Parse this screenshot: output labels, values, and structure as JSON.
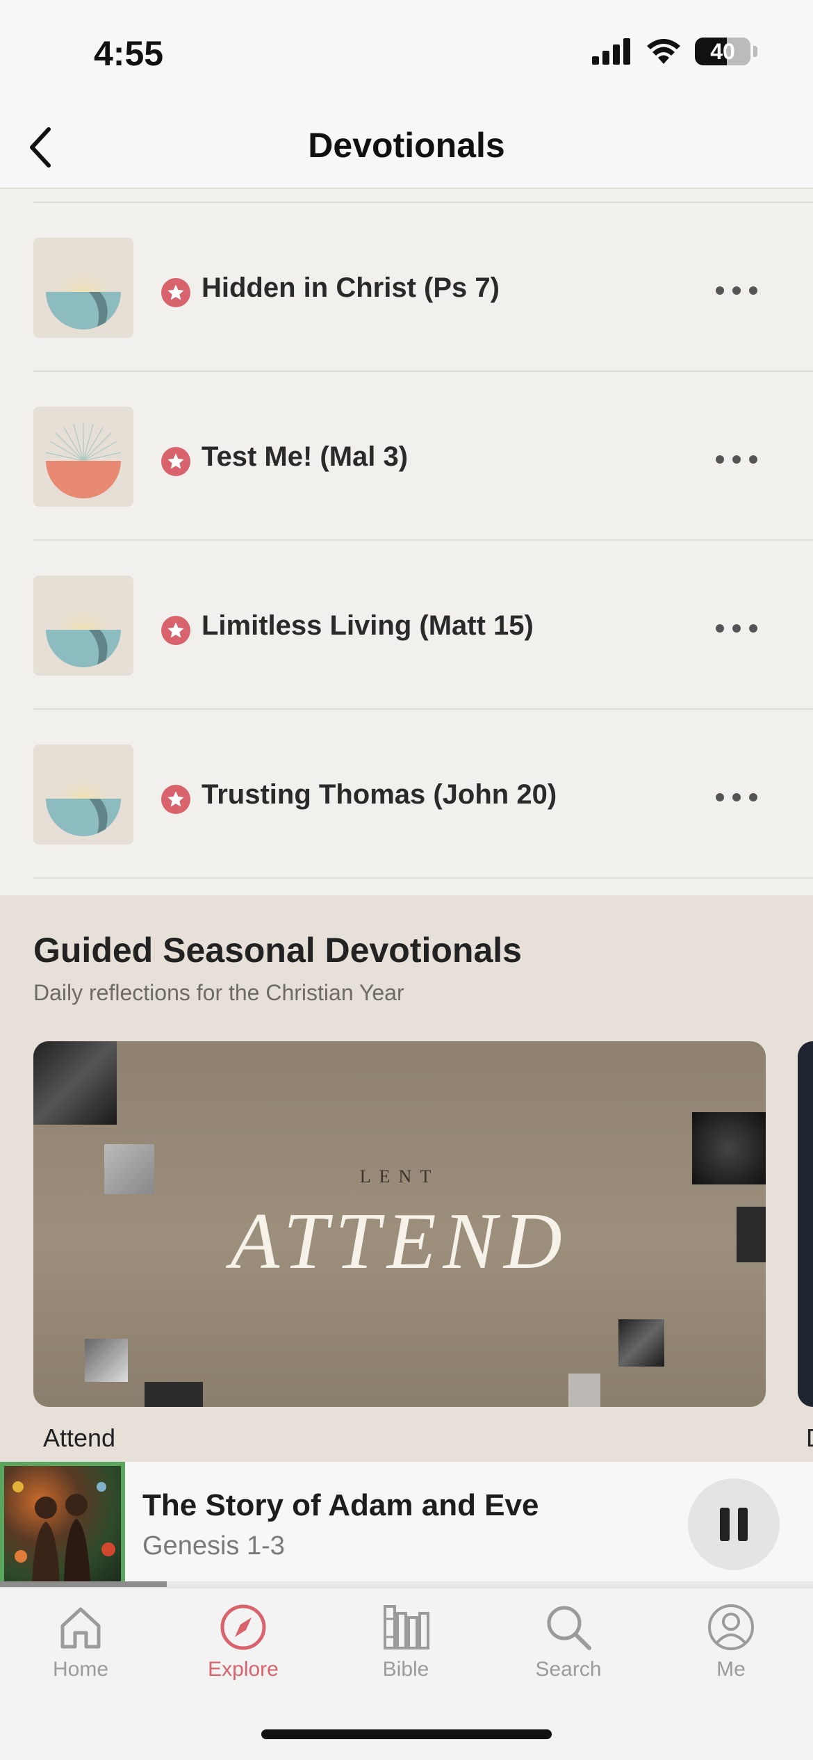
{
  "status_bar": {
    "time": "4:55",
    "battery_level": "40"
  },
  "header": {
    "title": "Devotionals",
    "back_icon": "chevron-left-icon"
  },
  "devotionals": [
    {
      "title": "Hidden in Christ (Ps 7)",
      "thumb": "teal-sunrise",
      "badge_icon": "star-icon"
    },
    {
      "title": "Test Me! (Mal 3)",
      "thumb": "coral-sunburst",
      "badge_icon": "star-icon"
    },
    {
      "title": "Limitless Living (Matt 15)",
      "thumb": "teal-sunrise",
      "badge_icon": "star-icon"
    },
    {
      "title": "Trusting Thomas (John 20)",
      "thumb": "teal-sunrise",
      "badge_icon": "star-icon"
    }
  ],
  "seasonal": {
    "title": "Guided Seasonal Devotionals",
    "subtitle": "Daily reflections for the Christian Year",
    "cards": [
      {
        "kicker": "LENT",
        "title": "ATTEND",
        "caption": "Attend"
      },
      {
        "kicker": "",
        "title": "",
        "caption": "D"
      }
    ]
  },
  "now_playing": {
    "title": "The Story of Adam and Eve",
    "subtitle": "Genesis 1-3",
    "progress": 0.205,
    "accent": "#5aa65e"
  },
  "tabs": [
    {
      "label": "Home",
      "icon": "home-icon",
      "active": false
    },
    {
      "label": "Explore",
      "icon": "compass-icon",
      "active": true
    },
    {
      "label": "Bible",
      "icon": "bible-books-icon",
      "active": false
    },
    {
      "label": "Search",
      "icon": "search-icon",
      "active": false
    },
    {
      "label": "Me",
      "icon": "user-icon",
      "active": false
    }
  ],
  "colors": {
    "accent": "#d9636c",
    "teal": "#8dbcc0",
    "coral": "#e88a73",
    "sun": "#f3de8f"
  }
}
